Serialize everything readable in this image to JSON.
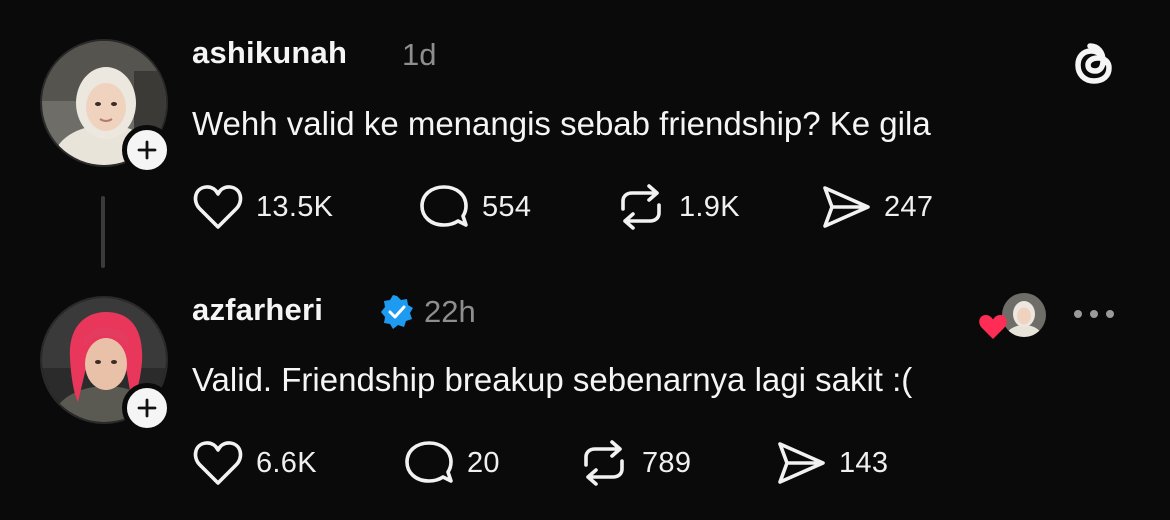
{
  "posts": [
    {
      "username": "ashikunah",
      "time": "1d",
      "text": "Wehh valid ke menangis sebab friendship? Ke gila",
      "stats": {
        "likes": "13.5K",
        "replies": "554",
        "reposts": "1.9K",
        "shares": "247"
      }
    },
    {
      "username": "azfarheri",
      "time": "22h",
      "verified": true,
      "text": "Valid. Friendship breakup sebenarnya lagi sakit :(",
      "stats": {
        "likes": "6.6K",
        "replies": "20",
        "reposts": "789",
        "shares": "143"
      }
    }
  ],
  "icons": {
    "app_logo": "threads-logo-icon",
    "like": "heart-icon",
    "reply": "reply-bubble-icon",
    "repost": "repost-icon",
    "share": "send-icon",
    "more": "more-options-icon",
    "follow": "plus-icon",
    "verified": "verified-badge-icon",
    "liked_by_author": "liked-by-author-heart-icon"
  },
  "colors": {
    "background": "#0a0a0a",
    "text": "#f5f5f5",
    "muted": "#8e8e8e",
    "verified": "#1d9bf0",
    "liked_heart": "#ff2d55"
  }
}
